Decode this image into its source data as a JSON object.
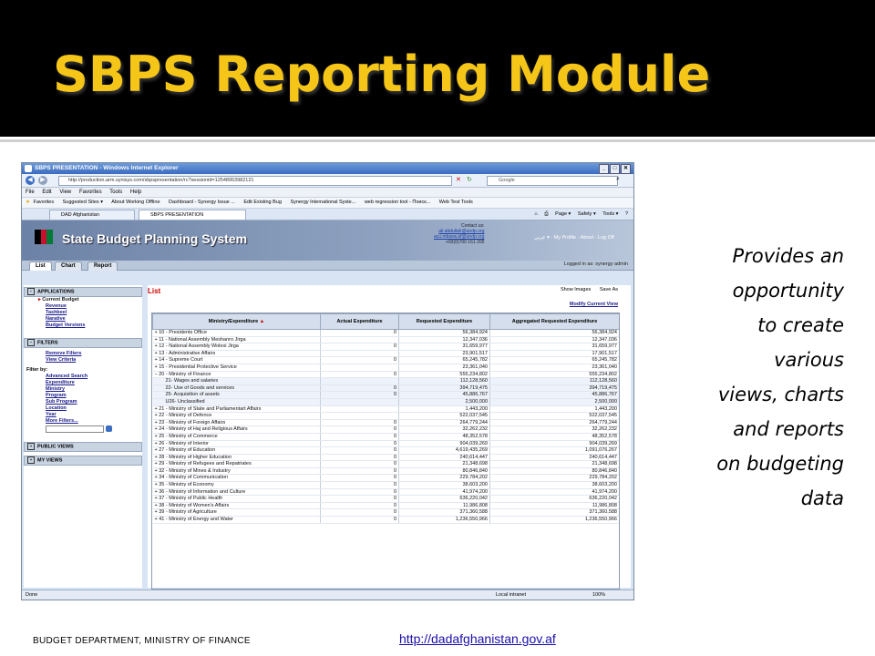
{
  "slide": {
    "title": "SBPS Reporting Module",
    "caption_lines": [
      "Provides an",
      "opportunity",
      "to create",
      "various",
      "views, charts",
      "and reports",
      "on budgeting",
      "data"
    ],
    "footer_left": "BUDGET DEPARTMENT, MINISTRY OF FINANCE",
    "footer_link": "http://dadafghanistan.gov.af"
  },
  "browser": {
    "title": "SBPS PRESENTATION - Windows Internet Explorer",
    "address": "http://production.arm.synisys.com/sbpspresentation/rc?sessionid=12548953982121",
    "search_placeholder": "Google",
    "menu": [
      "File",
      "Edit",
      "View",
      "Favorites",
      "Tools",
      "Help"
    ],
    "favorites": [
      "Favorites",
      "Suggested Sites ▾",
      "About Working Offline",
      "Dashboard - Synergy Issue ...",
      "Edit Existing Bug",
      "Synergy International Syste...",
      "web regression tool - Поиск...",
      "Web Test Tools"
    ],
    "tabs": [
      "DAD Afghanistan",
      "SBPS PRESENTATION"
    ],
    "tools": [
      "Page ▾",
      "Safety ▾",
      "Tools ▾"
    ],
    "status": {
      "left": "Done",
      "zone": "Local intranet",
      "zoom": "100%"
    }
  },
  "app": {
    "name": "State Budget Planning System",
    "contact_label": "Contact us:",
    "contacts": [
      "ali.abdullah@undp.org",
      "acu.mbasw.af@undp.org"
    ],
    "phone": "+93(0)700 161 205",
    "top_links": "عربي ▾  ·  My Profile  ·  About  ·  Log Off",
    "tabs": [
      "List",
      "Chart",
      "Report"
    ],
    "logged_in": "Logged in as: synergy admin"
  },
  "sidebar": {
    "applications_label": "APPLICATIONS",
    "applications": [
      "Current Budget",
      "Revenue",
      "Tashkeel",
      "Narative",
      "Budget Versions"
    ],
    "filters_label": "FILTERS",
    "filters": [
      "Remove Filters",
      "View Criteria"
    ],
    "filter_by_label": "Filter by:",
    "filter_by": [
      "Advanced Search",
      "Expenditure",
      "Ministry",
      "Program",
      "Sub Program",
      "Location",
      "Year",
      "More Filters..."
    ],
    "public_views_label": "PUBLIC VIEWS",
    "my_views_label": "MY VIEWS"
  },
  "main": {
    "title": "List",
    "show_images": "Show Images",
    "save_as": "Save As",
    "modify_view": "Modify Current View",
    "columns": [
      "Ministry/Expenditure",
      "Actual Expenditure",
      "Requested Expenditure",
      "Aggregated Requested Expenditure"
    ],
    "sort_indicator": "▲",
    "rows": [
      {
        "name": "+ 10 - Presidents Office",
        "actual": "0",
        "requested": "56,384,924",
        "aggregated": "56,384,924",
        "child": false
      },
      {
        "name": "+ 11 - National Assembly Meshanro Jirga",
        "actual": "",
        "requested": "12,347,036",
        "aggregated": "12,347,036",
        "child": false
      },
      {
        "name": "+ 12 - National Assembly Wolesi Jirga",
        "actual": "0",
        "requested": "31,659,977",
        "aggregated": "31,659,977",
        "child": false
      },
      {
        "name": "+ 13 - Administrative Affairs",
        "actual": "",
        "requested": "23,901,517",
        "aggregated": "17,901,517",
        "child": false
      },
      {
        "name": "+ 14 - Supreme Court",
        "actual": "0",
        "requested": "65,245,782",
        "aggregated": "65,245,782",
        "child": false
      },
      {
        "name": "+ 15 - Presidential Protective Service",
        "actual": "",
        "requested": "23,361,040",
        "aggregated": "23,361,040",
        "child": false
      },
      {
        "name": "− 20 - Ministry of Finance",
        "actual": "0",
        "requested": "555,234,802",
        "aggregated": "555,234,802",
        "child": false
      },
      {
        "name": "21- Wages and salaries",
        "actual": "",
        "requested": "112,128,560",
        "aggregated": "112,128,560",
        "child": true
      },
      {
        "name": "22- Use of Goods and services",
        "actual": "0",
        "requested": "394,719,475",
        "aggregated": "394,719,475",
        "child": true
      },
      {
        "name": "25- Acquisition of assets",
        "actual": "0",
        "requested": "45,886,767",
        "aggregated": "45,886,767",
        "child": true
      },
      {
        "name": "U26- Unclassified",
        "actual": "",
        "requested": "2,500,000",
        "aggregated": "2,500,000",
        "child": true
      },
      {
        "name": "+ 21 - Ministry of State and Parliamentart Affairs",
        "actual": "",
        "requested": "1,443,200",
        "aggregated": "1,443,200",
        "child": false
      },
      {
        "name": "+ 22 - Ministry of Defence",
        "actual": "",
        "requested": "522,037,545",
        "aggregated": "522,037,545",
        "child": false
      },
      {
        "name": "+ 23 - Ministry of Foreign Affairs",
        "actual": "0",
        "requested": "264,779,244",
        "aggregated": "264,779,244",
        "child": false
      },
      {
        "name": "+ 24 - Ministry of Haj and Religious Affairs",
        "actual": "0",
        "requested": "32,262,232",
        "aggregated": "32,262,232",
        "child": false
      },
      {
        "name": "+ 25 - Ministry of Commerce",
        "actual": "0",
        "requested": "48,352,578",
        "aggregated": "48,352,578",
        "child": false
      },
      {
        "name": "+ 26 - Ministry of Interior",
        "actual": "0",
        "requested": "904,039,269",
        "aggregated": "904,039,269",
        "child": false
      },
      {
        "name": "+ 27 - Ministry of Education",
        "actual": "0",
        "requested": "4,619,435,269",
        "aggregated": "1,091,076,267",
        "child": false
      },
      {
        "name": "+ 28 - Ministry of Higher Education",
        "actual": "0",
        "requested": "240,614,447",
        "aggregated": "240,614,447",
        "child": false
      },
      {
        "name": "+ 29 - Ministry of Refugees and Repatriates",
        "actual": "0",
        "requested": "21,348,698",
        "aggregated": "21,348,698",
        "child": false
      },
      {
        "name": "+ 32 - Ministry of Mines & Industry",
        "actual": "0",
        "requested": "80,846,840",
        "aggregated": "80,846,840",
        "child": false
      },
      {
        "name": "+ 34 - Ministry of Communication",
        "actual": "0",
        "requested": "229,784,202",
        "aggregated": "229,784,202",
        "child": false
      },
      {
        "name": "+ 35 - Ministry of Economy",
        "actual": "0",
        "requested": "38,603,200",
        "aggregated": "38,603,200",
        "child": false
      },
      {
        "name": "+ 36 - Ministry of Information and Culture",
        "actual": "0",
        "requested": "41,974,200",
        "aggregated": "41,974,200",
        "child": false
      },
      {
        "name": "+ 37 - Ministry of Public Health",
        "actual": "0",
        "requested": "636,220,042",
        "aggregated": "636,220,042",
        "child": false
      },
      {
        "name": "+ 38 - Ministry of Women's Affairs",
        "actual": "0",
        "requested": "11,986,808",
        "aggregated": "11,986,808",
        "child": false
      },
      {
        "name": "+ 39 - Ministry of Agriculture",
        "actual": "0",
        "requested": "371,360,588",
        "aggregated": "371,360,588",
        "child": false
      },
      {
        "name": "+ 41 - Ministry of Energy and Water",
        "actual": "0",
        "requested": "1,236,550,966",
        "aggregated": "1,236,550,966",
        "child": false
      }
    ]
  },
  "colors": {
    "title": "#f5c518",
    "slide_bg": "#000000",
    "link": "#1a0dab"
  }
}
